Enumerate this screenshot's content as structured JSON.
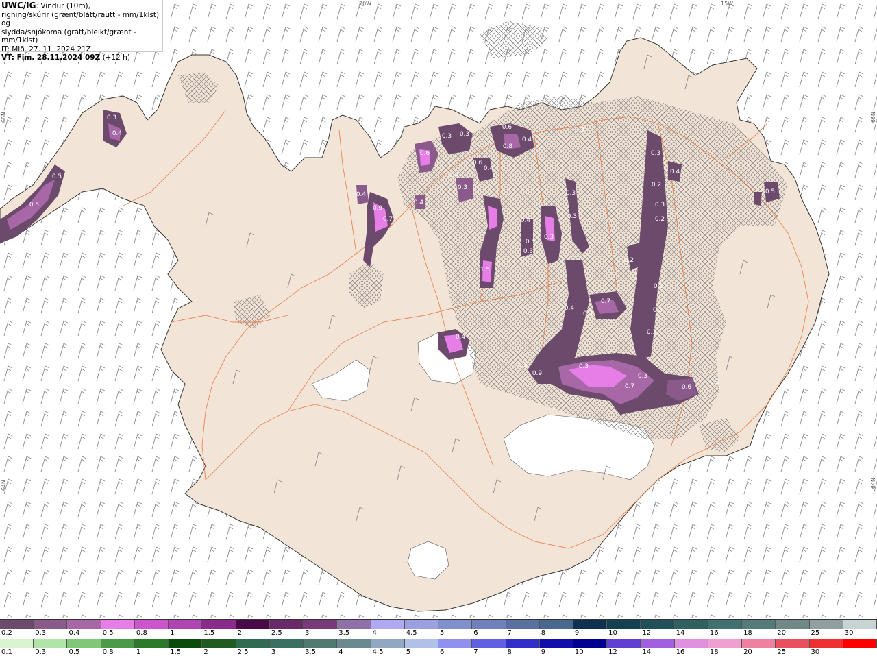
{
  "header": {
    "model": "UWC/IG",
    "line1_rest": ": Vindur (10m),",
    "line2": "rigning/skúrir (grænt/blátt/rautt - mm/1klst) og",
    "line3": "slydda/snjókoma (grátt/bleikt/grænt - mm/1klst)",
    "it_label": "IT: Mið. 27. 11. 2024 21Z",
    "vt_label": "VT: Fim. 28.11.2024 09Z",
    "vt_offset": " (+12 h)"
  },
  "coords": {
    "top_left": "20W",
    "top_right": "15W",
    "left_upper": "66N",
    "left_lower": "64N",
    "right_upper": "66N",
    "right_lower": "64N"
  },
  "precip_labels": [
    "0.3",
    "0.4",
    "0.5",
    "0.5",
    "0.4",
    "0.9",
    "0.7",
    "0.4",
    "0.6",
    "0.3",
    "0.3",
    "0.6",
    "0.4",
    "0.4",
    "0.3",
    "0.8",
    "0.4",
    "0.6",
    "0.4",
    "0.5",
    "0.3",
    "0.3",
    "0.3",
    "0.3",
    "0.3",
    "0.2",
    "0.3",
    "0.2",
    "0.2",
    "0.3",
    "0.3",
    "0.3",
    "0.4",
    "0.3",
    "0.7",
    "0.4",
    "0.5",
    "0.9",
    "0.3",
    "0.3",
    "0.7",
    "0.6",
    "0.4",
    "0.5",
    "0.3",
    "1.5",
    "0.3"
  ],
  "snow_scale": {
    "colors": [
      "#6b4a6b",
      "#8a5a8a",
      "#a868a8",
      "#e77de7",
      "#cc55cc",
      "#b044b0",
      "#8a2a8a",
      "#4a0a4a",
      "#6a2a6a",
      "#7a3a7a",
      "#9070a8",
      "#b0a8f0",
      "#9aa0e0",
      "#8090cc",
      "#7080bb",
      "#5a70a0",
      "#486890",
      "#103050",
      "#154050",
      "#205058",
      "#306060",
      "#407070",
      "#557a7a",
      "#708888",
      "#90a0a0",
      "#c8d4d4"
    ],
    "labels": [
      "0.2",
      "0.3",
      "0.4",
      "0.5",
      "0.8",
      "1",
      "1.5",
      "2",
      "2.5",
      "3",
      "3.5",
      "4",
      "4.5",
      "5",
      "6",
      "7",
      "8",
      "9",
      "10",
      "12",
      "14",
      "16",
      "18",
      "20",
      "25",
      "30"
    ]
  },
  "rain_scale": {
    "colors": [
      "#d8f5d0",
      "#b0e4a8",
      "#80c878",
      "#4a9a48",
      "#2a7a2a",
      "#0a4a0a",
      "#205a20",
      "#306a50",
      "#3a7060",
      "#507a70",
      "#6a8a90",
      "#90a8c0",
      "#b0c0e8",
      "#9090f0",
      "#6060e0",
      "#3030c8",
      "#1010a8",
      "#000090",
      "#6040d0",
      "#a060e0",
      "#e090e0",
      "#f0a0d0",
      "#f080a0",
      "#e85060",
      "#f03030",
      "#ff0000"
    ],
    "labels": [
      "0.1",
      "0.3",
      "0.5",
      "0.8",
      "1",
      "1.5",
      "2",
      "2.5",
      "3",
      "3.5",
      "4",
      "4.5",
      "5",
      "6",
      "7",
      "8",
      "9",
      "10",
      "12",
      "14",
      "16",
      "18",
      "20",
      "25",
      "30"
    ]
  }
}
